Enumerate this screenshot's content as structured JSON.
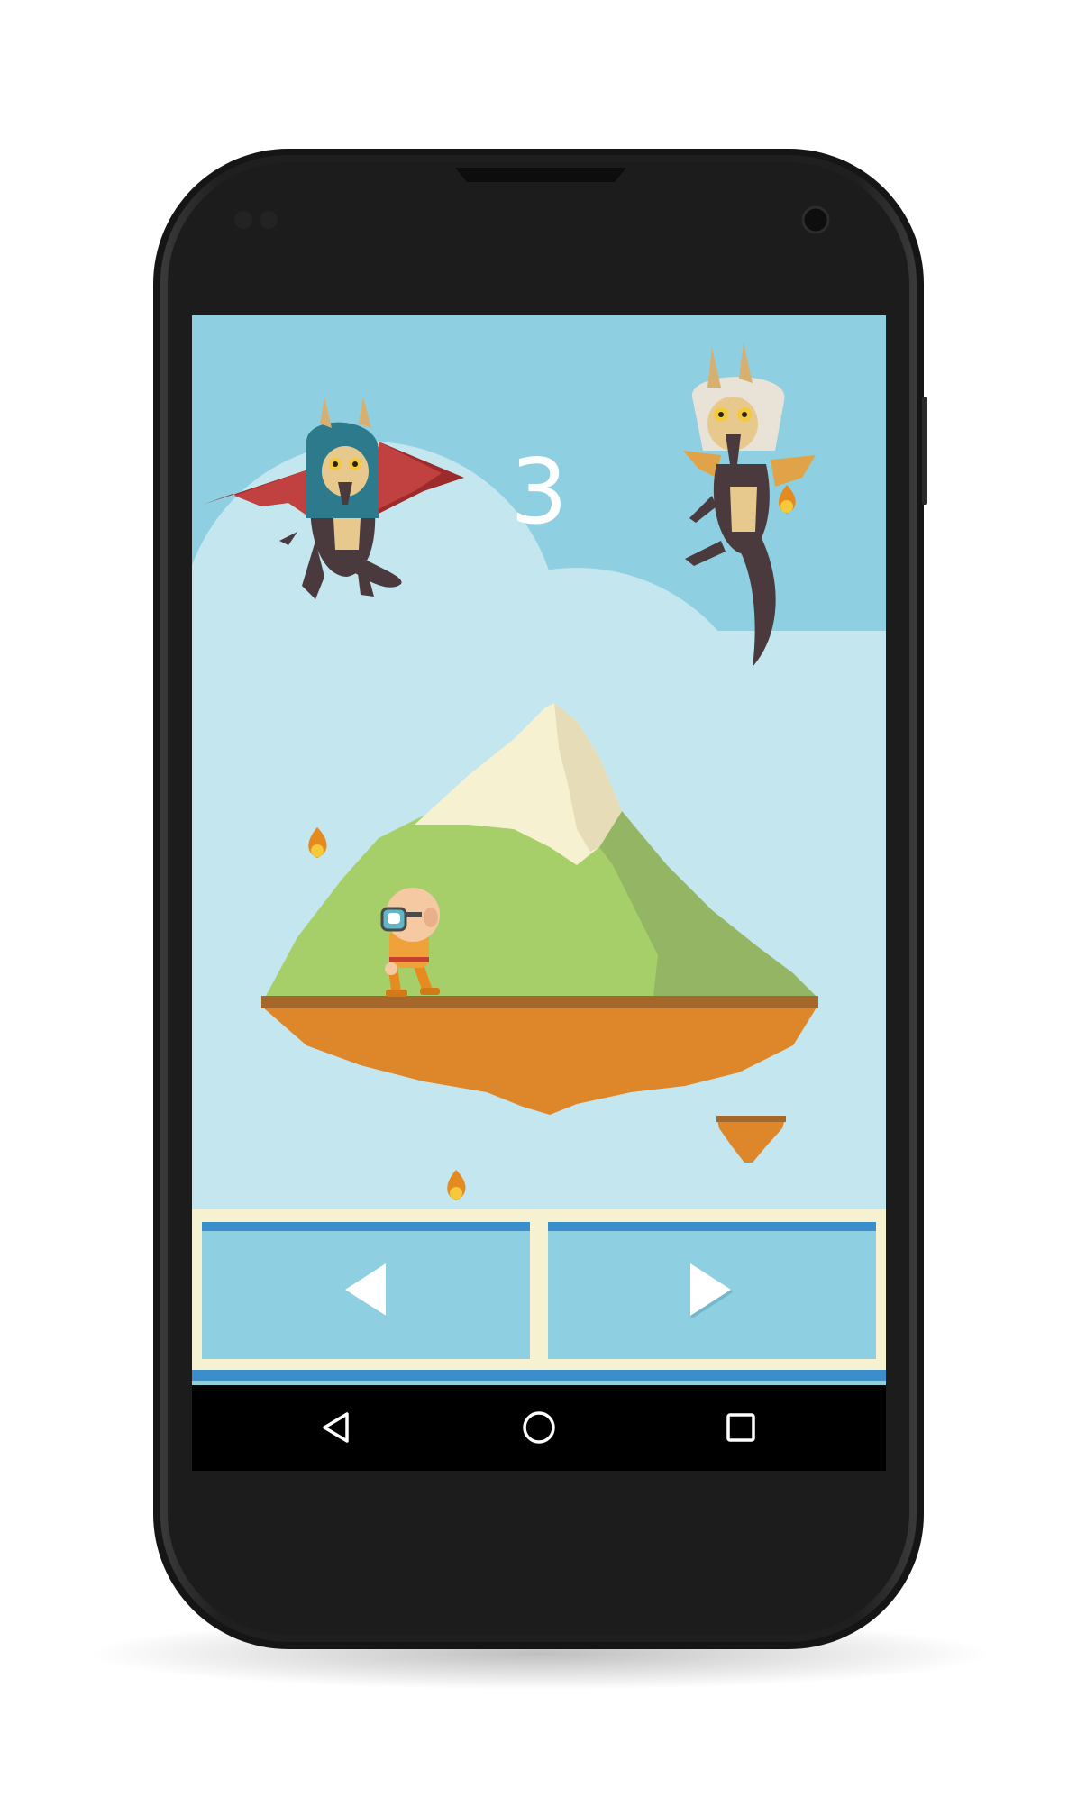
{
  "game": {
    "score": "3"
  },
  "controls": {
    "left_icon": "left-arrow-icon",
    "right_icon": "right-arrow-icon"
  },
  "nav_bar": {
    "back_icon": "back-triangle-icon",
    "home_icon": "home-circle-icon",
    "recents_icon": "recents-square-icon"
  },
  "colors": {
    "sky": "#8ED0E2",
    "cloud": "#C3E6EF",
    "grass_light": "#A6CF6A",
    "grass_dark": "#94B563",
    "snow": "#F6F1D1",
    "dirt": "#DD862A",
    "dirt_edge": "#A6682A",
    "control_bg": "#8ED0E2",
    "control_frame": "#F6F1D1",
    "control_stripe": "#3A8ECC",
    "nav_bar": "#000000"
  }
}
